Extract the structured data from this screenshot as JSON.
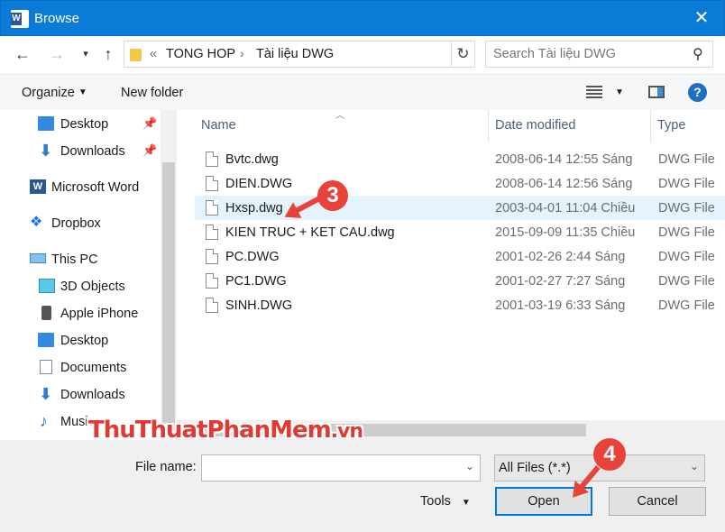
{
  "window": {
    "title": "Browse",
    "app_icon": "word-icon"
  },
  "address": {
    "crumb_overflow": "«",
    "crumbs": [
      "TONG HOP",
      "Tài liệu DWG"
    ],
    "search_placeholder": "Search Tài liệu DWG"
  },
  "toolbar": {
    "organize": "Organize",
    "new_folder": "New folder"
  },
  "nav": {
    "items": [
      {
        "label": "Desktop",
        "icon": "desktop-folder-icon",
        "pinned": true
      },
      {
        "label": "Downloads",
        "icon": "downloads-icon",
        "pinned": true
      },
      {
        "label": "Microsoft Word",
        "icon": "word-icon"
      },
      {
        "label": "Dropbox",
        "icon": "dropbox-icon"
      },
      {
        "label": "This PC",
        "icon": "computer-icon"
      },
      {
        "label": "3D Objects",
        "icon": "3d-objects-icon"
      },
      {
        "label": "Apple iPhone",
        "icon": "phone-icon"
      },
      {
        "label": "Desktop",
        "icon": "desktop-folder-icon"
      },
      {
        "label": "Documents",
        "icon": "documents-icon"
      },
      {
        "label": "Downloads",
        "icon": "downloads-icon"
      },
      {
        "label": "Music",
        "icon": "music-icon"
      }
    ]
  },
  "columns": {
    "name": "Name",
    "date": "Date modified",
    "type": "Type"
  },
  "files": [
    {
      "name": "Bvtc.dwg",
      "date": "2008-06-14 12:55 Sáng",
      "type": "DWG File"
    },
    {
      "name": "DIEN.DWG",
      "date": "2008-06-14 12:56 Sáng",
      "type": "DWG File"
    },
    {
      "name": "Hxsp.dwg",
      "date": "2003-04-01 11:04 Chiều",
      "type": "DWG File"
    },
    {
      "name": "KIEN TRUC + KET CAU.dwg",
      "date": "2015-09-09 11:35 Chiều",
      "type": "DWG File"
    },
    {
      "name": "PC.DWG",
      "date": "2001-02-26 2:44 Sáng",
      "type": "DWG File"
    },
    {
      "name": "PC1.DWG",
      "date": "2001-02-27 7:27 Sáng",
      "type": "DWG File"
    },
    {
      "name": "SINH.DWG",
      "date": "2001-03-19 6:33 Sáng",
      "type": "DWG File"
    }
  ],
  "selected_file": "Hxsp.dwg",
  "bottom": {
    "file_name_label": "File name:",
    "file_name_value": "",
    "filter": "All Files (*.*)",
    "tools": "Tools",
    "open": "Open",
    "cancel": "Cancel"
  },
  "annotations": {
    "step3": "3",
    "step4": "4"
  },
  "watermark": {
    "main": "ThuThuatPhanMem",
    "domain": ".vn"
  },
  "colors": {
    "titlebar": "#0a7bd7",
    "selection": "#e5f3ff",
    "callout": "#e8423b",
    "primary_button_border": "#0078d7"
  }
}
